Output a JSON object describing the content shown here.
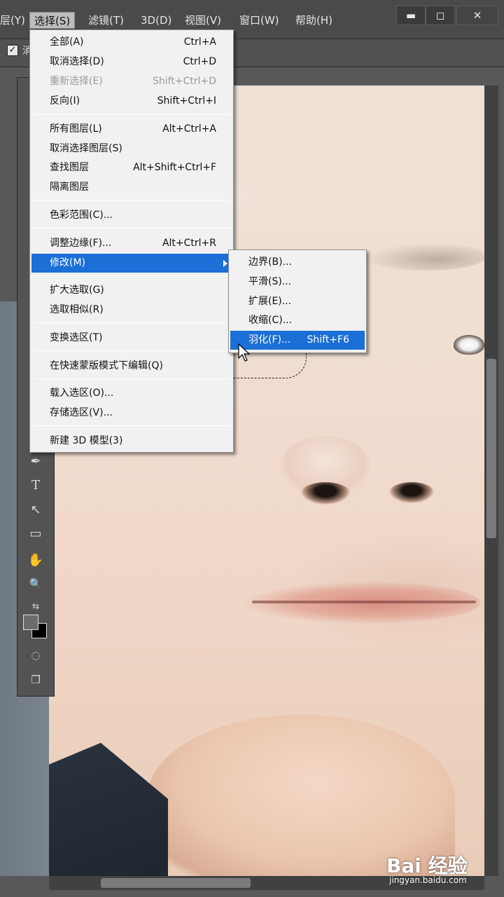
{
  "menubar": {
    "items": [
      {
        "label": "层(Y)"
      },
      {
        "label": "选择(S)"
      },
      {
        "label": "滤镜(T)"
      },
      {
        "label": "3D(D)"
      },
      {
        "label": "视图(V)"
      },
      {
        "label": "窗口(W)"
      },
      {
        "label": "帮助(H)"
      }
    ],
    "window_buttons": {
      "minimize": "▬",
      "maximize": "◻",
      "close": "✕"
    }
  },
  "options_bar": {
    "checkbox_fragment": "消"
  },
  "select_menu": {
    "items": [
      {
        "label": "全部(A)",
        "shortcut": "Ctrl+A"
      },
      {
        "label": "取消选择(D)",
        "shortcut": "Ctrl+D"
      },
      {
        "label": "重新选择(E)",
        "shortcut": "Shift+Ctrl+D",
        "disabled": true
      },
      {
        "label": "反向(I)",
        "shortcut": "Shift+Ctrl+I"
      },
      {
        "label": "所有图层(L)",
        "shortcut": "Alt+Ctrl+A"
      },
      {
        "label": "取消选择图层(S)",
        "shortcut": ""
      },
      {
        "label": "查找图层",
        "shortcut": "Alt+Shift+Ctrl+F"
      },
      {
        "label": "隔离图层",
        "shortcut": ""
      },
      {
        "label": "色彩范围(C)...",
        "shortcut": ""
      },
      {
        "label": "调整边缘(F)...",
        "shortcut": "Alt+Ctrl+R"
      },
      {
        "label": "修改(M)",
        "shortcut": ""
      },
      {
        "label": "扩大选取(G)",
        "shortcut": ""
      },
      {
        "label": "选取相似(R)",
        "shortcut": ""
      },
      {
        "label": "变换选区(T)",
        "shortcut": ""
      },
      {
        "label": "在快速蒙版模式下编辑(Q)",
        "shortcut": ""
      },
      {
        "label": "载入选区(O)...",
        "shortcut": ""
      },
      {
        "label": "存储选区(V)...",
        "shortcut": ""
      },
      {
        "label": "新建 3D 模型(3)",
        "shortcut": ""
      }
    ]
  },
  "modify_submenu": {
    "items": [
      {
        "label": "边界(B)...",
        "shortcut": ""
      },
      {
        "label": "平滑(S)...",
        "shortcut": ""
      },
      {
        "label": "扩展(E)...",
        "shortcut": ""
      },
      {
        "label": "收缩(C)...",
        "shortcut": ""
      },
      {
        "label": "羽化(F)...",
        "shortcut": "Shift+F6"
      }
    ]
  },
  "toolbar": {
    "tools": [
      {
        "icon": "pen-icon",
        "glyph": "✒"
      },
      {
        "icon": "type-icon",
        "glyph": "T"
      },
      {
        "icon": "path-selection-icon",
        "glyph": "↖"
      },
      {
        "icon": "rectangle-icon",
        "glyph": "▭"
      },
      {
        "icon": "hand-icon",
        "glyph": "✋"
      },
      {
        "icon": "zoom-icon",
        "glyph": "🔍"
      }
    ]
  },
  "watermark": {
    "logo": "Bai 经验",
    "url": "jingyan.baidu.com"
  },
  "colors": {
    "highlight": "#1c6fd6",
    "menu_bg": "#f1f1f1",
    "app_bg": "#4a4a4a"
  }
}
